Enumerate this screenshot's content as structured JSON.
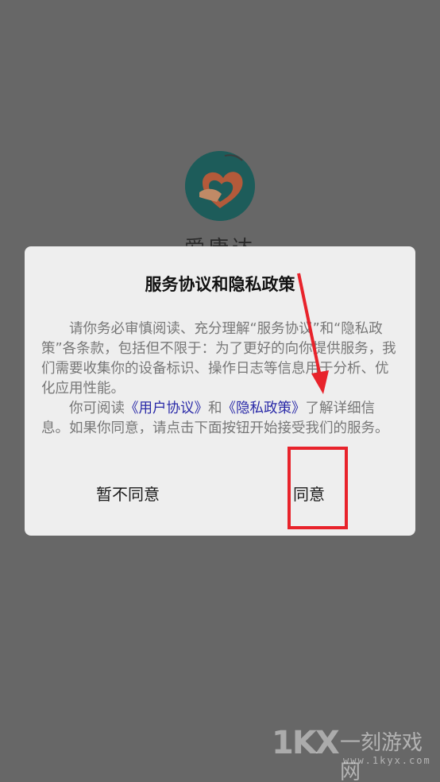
{
  "app": {
    "name": "爱康达",
    "logo_icon": "heart-hands-logo-icon"
  },
  "dialog": {
    "title": "服务协议和隐私政策",
    "paragraph1": "请你务必审慎阅读、充分理解“服务协议”和“隐私政策”各条款，包括但不限于：为了更好的向你提供服务，我们需要收集你的设备标识、操作日志等信息用于分析、优化应用性能。",
    "paragraph2_prefix": "你可阅读",
    "user_agreement_link": "《用户协议》",
    "paragraph2_and": "和",
    "privacy_policy_link": "《隐私政策》",
    "paragraph2_suffix": "了解详细信息。如果你同意，请点击下面按钮开始接受我们的服务。",
    "disagree_label": "暂不同意",
    "agree_label": "同意"
  },
  "annotation": {
    "color": "#e8232b"
  },
  "watermark": {
    "logo": "1KX",
    "title": "一刻游戏网",
    "url": "www.1kyx.com"
  }
}
